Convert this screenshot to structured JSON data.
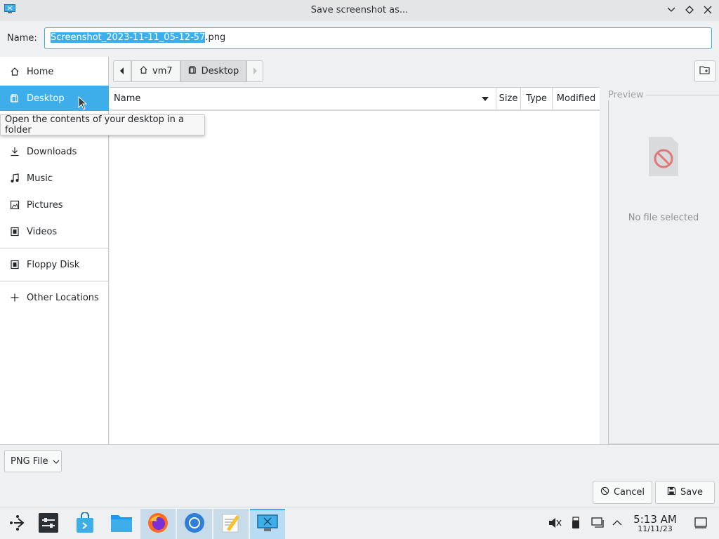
{
  "window": {
    "title": "Save screenshot as..."
  },
  "name_row": {
    "label": "Name:",
    "value_selected": "Screenshot_2023-11-11_05-12-57",
    "value_ext": ".png"
  },
  "sidebar": {
    "items": [
      {
        "label": "Home",
        "icon": "home-icon"
      },
      {
        "label": "Desktop",
        "icon": "desktop-folder-icon",
        "active": true
      },
      {
        "label": "Downloads",
        "icon": "download-icon"
      },
      {
        "label": "Music",
        "icon": "music-icon"
      },
      {
        "label": "Pictures",
        "icon": "pictures-icon"
      },
      {
        "label": "Videos",
        "icon": "videos-icon"
      },
      {
        "label": "Floppy Disk",
        "icon": "floppy-icon"
      },
      {
        "label": "Other Locations",
        "icon": "plus-icon"
      }
    ]
  },
  "tooltip": {
    "text": "Open the contents of your desktop in a folder"
  },
  "pathbar": {
    "crumbs": [
      {
        "label": "vm7",
        "icon": "home-icon"
      },
      {
        "label": "Desktop",
        "icon": "desktop-folder-icon"
      }
    ]
  },
  "file_list": {
    "columns": [
      "Name",
      "Size",
      "Type",
      "Modified"
    ]
  },
  "preview": {
    "label": "Preview",
    "empty_text": "No file selected"
  },
  "bottom": {
    "filter_value": "PNG File",
    "cancel_label": "Cancel",
    "save_label": "Save"
  },
  "taskbar": {
    "apps": [
      "application-launcher",
      "system-settings",
      "discover-store",
      "file-manager",
      "firefox",
      "chromium",
      "text-editor",
      "screenshot-tool"
    ],
    "clock_time": "5:13 AM",
    "clock_date": "11/11/23"
  },
  "colors": {
    "accent": "#3daee9",
    "window_bg": "#eff0f1"
  }
}
